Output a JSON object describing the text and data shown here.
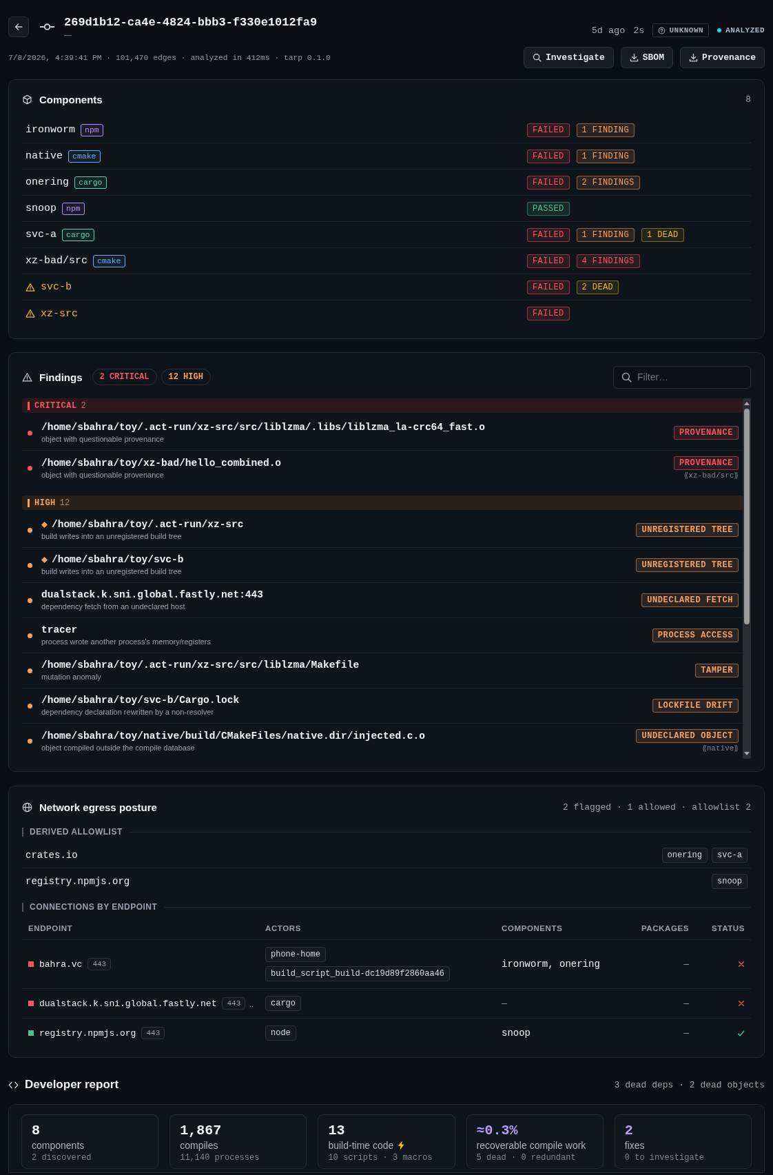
{
  "header": {
    "title": "269d1b12-ca4e-4824-bbb3-f330e1012fa9",
    "subtitle": "—",
    "age": "5d ago",
    "duration": "2s",
    "verdict": "UNKNOWN",
    "status": "ANALYZED",
    "meta": "7/8/2026, 4:39:41 PM · 101,470 edges · analyzed in 412ms · tarp 0.1.0",
    "buttons": [
      {
        "label": "Investigate",
        "kind": "search"
      },
      {
        "label": "SBOM",
        "kind": "download"
      },
      {
        "label": "Provenance",
        "kind": "download"
      }
    ]
  },
  "components": {
    "title": "Components",
    "count": "8",
    "items": [
      {
        "name": "ironworm",
        "warning": false,
        "ecosystem": {
          "label": "npm",
          "color": "#b48cf2"
        },
        "badges": [
          {
            "text": "FAILED",
            "kind": "fail"
          },
          {
            "text": "1 FINDING",
            "kind": "high"
          }
        ]
      },
      {
        "name": "native",
        "warning": false,
        "ecosystem": {
          "label": "cmake",
          "color": "#6ea8f7"
        },
        "badges": [
          {
            "text": "FAILED",
            "kind": "fail"
          },
          {
            "text": "1 FINDING",
            "kind": "high"
          }
        ]
      },
      {
        "name": "onering",
        "warning": false,
        "ecosystem": {
          "label": "cargo",
          "color": "#5ccfb4"
        },
        "badges": [
          {
            "text": "FAILED",
            "kind": "fail"
          },
          {
            "text": "2 FINDINGS",
            "kind": "high"
          }
        ]
      },
      {
        "name": "snoop",
        "warning": false,
        "ecosystem": {
          "label": "npm",
          "color": "#b48cf2"
        },
        "badges": [
          {
            "text": "PASSED",
            "kind": "pass"
          }
        ]
      },
      {
        "name": "svc-a",
        "warning": false,
        "ecosystem": {
          "label": "cargo",
          "color": "#5ccfb4"
        },
        "badges": [
          {
            "text": "FAILED",
            "kind": "fail"
          },
          {
            "text": "1 FINDING",
            "kind": "high"
          },
          {
            "text": "1 DEAD",
            "kind": "dead"
          }
        ]
      },
      {
        "name": "xz-bad/src",
        "warning": false,
        "ecosystem": {
          "label": "cmake",
          "color": "#6ea8f7"
        },
        "badges": [
          {
            "text": "FAILED",
            "kind": "fail"
          },
          {
            "text": "4 FINDINGS",
            "kind": "critical"
          }
        ]
      },
      {
        "name": "svc-b",
        "warning": true,
        "badges": [
          {
            "text": "FAILED",
            "kind": "fail"
          },
          {
            "text": "2 DEAD",
            "kind": "dead"
          }
        ]
      },
      {
        "name": "xz-src",
        "warning": true,
        "badges": [
          {
            "text": "FAILED",
            "kind": "fail"
          }
        ]
      }
    ]
  },
  "findings": {
    "title": "Findings",
    "counts": [
      {
        "text": "2 CRITICAL",
        "kind": "critical"
      },
      {
        "text": "12 HIGH",
        "kind": "high"
      }
    ],
    "filter": {
      "placeholder": "Filter…"
    },
    "groups": [
      {
        "label": "CRITICAL",
        "count": "2",
        "kind": "critical",
        "items": [
          {
            "path": "/home/sbahra/toy/.act-run/xz-src/src/liblzma/.libs/liblzma_la-crc64_fast.o",
            "description": "object with questionable provenance",
            "tag": "PROVENANCE",
            "diamond": false
          },
          {
            "path": "/home/sbahra/toy/xz-bad/hello_combined.o",
            "description": "object with questionable provenance",
            "tag": "PROVENANCE",
            "note": "⟪xz-bad/src⟫",
            "diamond": false
          }
        ]
      },
      {
        "label": "HIGH",
        "count": "12",
        "kind": "high",
        "items": [
          {
            "path": "/home/sbahra/toy/.act-run/xz-src",
            "description": "build writes into an unregistered build tree",
            "tag": "UNREGISTERED TREE",
            "diamond": true
          },
          {
            "path": "/home/sbahra/toy/svc-b",
            "description": "build writes into an unregistered build tree",
            "tag": "UNREGISTERED TREE",
            "diamond": true
          },
          {
            "path": "dualstack.k.sni.global.fastly.net:443",
            "description": "dependency fetch from an undeclared host",
            "tag": "UNDECLARED FETCH",
            "diamond": false
          },
          {
            "path": "tracer",
            "description": "process wrote another process's memory/registers",
            "tag": "PROCESS ACCESS",
            "diamond": false
          },
          {
            "path": "/home/sbahra/toy/.act-run/xz-src/src/liblzma/Makefile",
            "description": "mutation anomaly",
            "tag": "TAMPER",
            "diamond": false
          },
          {
            "path": "/home/sbahra/toy/svc-b/Cargo.lock",
            "description": "dependency declaration rewritten by a non-resolver",
            "tag": "LOCKFILE DRIFT",
            "diamond": false
          },
          {
            "path": "/home/sbahra/toy/native/build/CMakeFiles/native.dir/injected.c.o",
            "description": "object compiled outside the compile database",
            "tag": "UNDECLARED OBJECT",
            "note": "⟪native⟫",
            "diamond": false
          }
        ]
      }
    ]
  },
  "network": {
    "title": "Network egress posture",
    "summary": "2 flagged · 1 allowed · allowlist 2",
    "allowlist": {
      "title": "DERIVED ALLOWLIST",
      "rows": [
        {
          "host": "crates.io",
          "components": [
            "onering",
            "svc-a"
          ]
        },
        {
          "host": "registry.npmjs.org",
          "components": [
            "snoop"
          ]
        }
      ]
    },
    "connections": {
      "title": "CONNECTIONS BY ENDPOINT",
      "columns": [
        "ENDPOINT",
        "ACTORS",
        "COMPONENTS",
        "PACKAGES",
        "STATUS"
      ],
      "rows": [
        {
          "endpoint": {
            "host": "bahra.vc",
            "port": "443"
          },
          "actors": [
            "phone-home",
            "build_script_build-dc19d89f2860aa46"
          ],
          "components": "ironworm, onering",
          "packages": "—",
          "allowed": false
        },
        {
          "endpoint": {
            "host": "dualstack.k.sni.global.fastly.net",
            "port": "443",
            "overflow": "‥"
          },
          "actors": [
            "cargo"
          ],
          "components": "—",
          "packages": "—",
          "allowed": false
        },
        {
          "endpoint": {
            "host": "registry.npmjs.org",
            "port": "443"
          },
          "actors": [
            "node"
          ],
          "components": "snoop",
          "packages": "—",
          "allowed": true
        }
      ]
    }
  },
  "developer_report": {
    "title": "Developer report",
    "summary": "3 dead deps · 2 dead objects",
    "stats": [
      {
        "value": "8",
        "label": "components",
        "detail": "2 discovered",
        "kind": "plain",
        "highlight": false
      },
      {
        "value": "1,867",
        "label": "compiles",
        "detail": "11,140 processes",
        "kind": "plain",
        "highlight": false
      },
      {
        "value": "13",
        "label": "build-time code",
        "detail": "10 scripts · 3 macros",
        "kind": "flash",
        "highlight": false
      },
      {
        "value": "≈0.3%",
        "label": "recoverable compile work",
        "detail": "5 dead · 0 redundant",
        "kind": "plain",
        "highlight": true
      },
      {
        "value": "2",
        "label": "fixes",
        "detail": "0 to investigate",
        "kind": "plain",
        "highlight": true
      }
    ]
  }
}
